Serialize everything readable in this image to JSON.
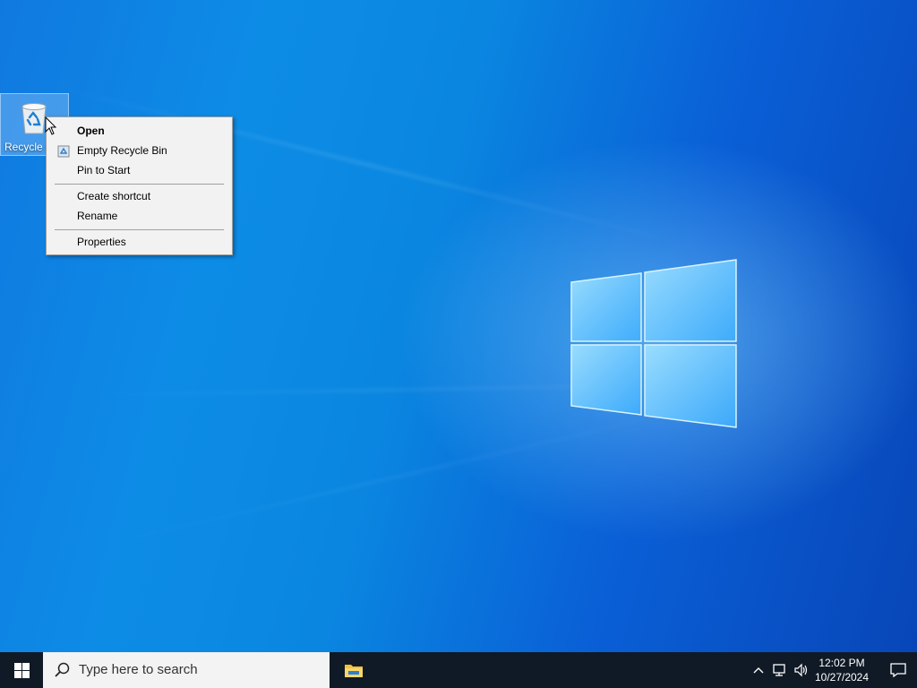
{
  "desktop": {
    "icons": [
      {
        "label": "Recycle Bin",
        "icon": "recycle-bin-icon"
      }
    ]
  },
  "context_menu": {
    "items": [
      {
        "label": "Open",
        "bold": true
      },
      {
        "label": "Empty Recycle Bin",
        "icon": "recycle-shield-icon"
      },
      {
        "label": "Pin to Start"
      },
      {
        "label": "Create shortcut"
      },
      {
        "label": "Rename"
      },
      {
        "label": "Properties"
      }
    ]
  },
  "taskbar": {
    "search_placeholder": "Type here to search",
    "pinned": [
      {
        "name": "File Explorer",
        "icon": "folder-icon"
      }
    ],
    "tray": {
      "time": "12:02 PM",
      "date": "10/27/2024",
      "icons": [
        "chevron-up-icon",
        "network-icon",
        "volume-icon",
        "notification-icon"
      ]
    }
  },
  "colors": {
    "desktop_accent": "#0a86e0",
    "taskbar_bg": "#101a26",
    "menu_bg": "#f2f2f2"
  }
}
